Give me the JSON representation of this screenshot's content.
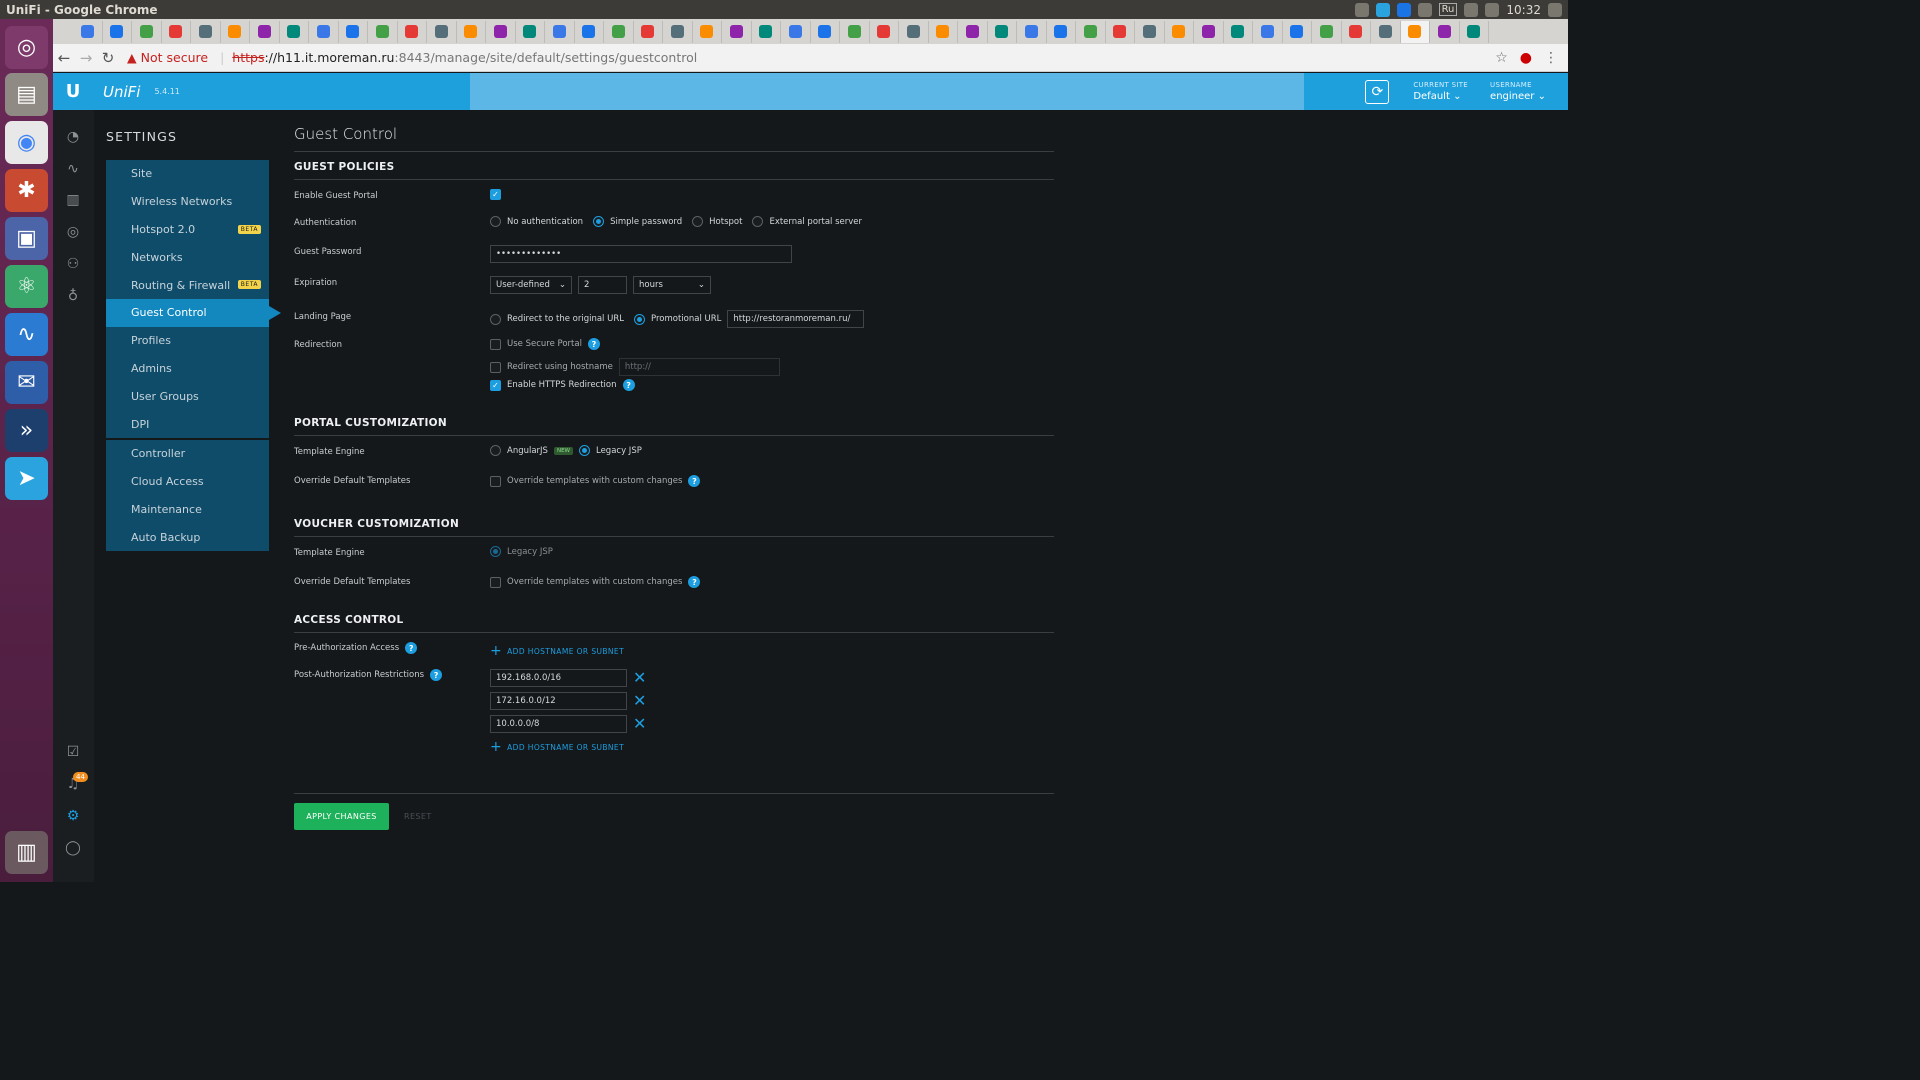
{
  "window": {
    "title": "UniFi - Google Chrome",
    "clock": "10:32",
    "keyboard_layout": "Ru"
  },
  "launcher": {
    "apps": [
      "ubuntu-icon",
      "files-icon",
      "chrome-icon",
      "settings-icon",
      "remote-desktop-icon",
      "atom-icon",
      "system-monitor-icon",
      "thunderbird-icon",
      "vpn-icon",
      "telegram-icon",
      "trash-icon"
    ]
  },
  "address_bar": {
    "security_label": "Not secure",
    "url_scheme": "https",
    "url_host": "://h11.it.moreman.ru",
    "url_path": ":8443/manage/site/default/settings/guestcontrol"
  },
  "header": {
    "version": "5.4.11",
    "brand": "UniFi",
    "current_site_label": "CURRENT SITE",
    "current_site_value": "Default",
    "username_label": "USERNAME",
    "username_value": "engineer"
  },
  "sidebar": {
    "title": "SETTINGS",
    "group1": [
      {
        "label": "Site"
      },
      {
        "label": "Wireless Networks"
      },
      {
        "label": "Hotspot 2.0",
        "badge": "BETA"
      },
      {
        "label": "Networks"
      },
      {
        "label": "Routing & Firewall",
        "badge": "BETA"
      },
      {
        "label": "Guest Control",
        "active": true
      },
      {
        "label": "Profiles"
      },
      {
        "label": "Admins"
      },
      {
        "label": "User Groups"
      },
      {
        "label": "DPI"
      }
    ],
    "group2": [
      {
        "label": "Controller"
      },
      {
        "label": "Cloud Access"
      },
      {
        "label": "Maintenance"
      },
      {
        "label": "Auto Backup"
      }
    ],
    "notification_count": "44"
  },
  "page": {
    "title": "Guest Control",
    "guest_policies": {
      "heading": "GUEST POLICIES",
      "enable_portal_label": "Enable Guest Portal",
      "authentication_label": "Authentication",
      "auth_options": [
        "No authentication",
        "Simple password",
        "Hotspot",
        "External portal server"
      ],
      "auth_selected": "Simple password",
      "guest_password_label": "Guest Password",
      "guest_password_value": "•••••••••••••",
      "expiration_label": "Expiration",
      "expiration_mode": "User-defined",
      "expiration_amount": "2",
      "expiration_unit": "hours",
      "landing_page_label": "Landing Page",
      "landing_original": "Redirect to the original URL",
      "landing_promotional": "Promotional URL",
      "promotional_url": "http://restoranmoreman.ru/",
      "redirection_label": "Redirection",
      "use_secure_portal": "Use Secure Portal",
      "redirect_hostname": "Redirect using hostname",
      "hostname_placeholder": "http://",
      "enable_https": "Enable HTTPS Redirection"
    },
    "portal_customization": {
      "heading": "PORTAL CUSTOMIZATION",
      "template_engine_label": "Template Engine",
      "option_angular": "AngularJS",
      "new_tag": "NEW",
      "option_legacy": "Legacy JSP",
      "override_label": "Override Default Templates",
      "override_option": "Override templates with custom changes"
    },
    "voucher_customization": {
      "heading": "VOUCHER CUSTOMIZATION",
      "template_engine_label": "Template Engine",
      "option_legacy": "Legacy JSP",
      "override_label": "Override Default Templates",
      "override_option": "Override templates with custom changes"
    },
    "access_control": {
      "heading": "ACCESS CONTROL",
      "pre_auth_label": "Pre-Authorization Access",
      "post_auth_label": "Post-Authorization Restrictions",
      "add_link": "ADD HOSTNAME OR SUBNET",
      "post_auth_subnets": [
        "192.168.0.0/16",
        "172.16.0.0/12",
        "10.0.0.0/8"
      ]
    },
    "apply_label": "APPLY CHANGES",
    "reset_label": "RESET"
  },
  "colors": {
    "accent": "#1ea0dd",
    "apply": "#1eb15b",
    "nav_active": "#1288be",
    "nav_bg": "#0f4c6a"
  }
}
